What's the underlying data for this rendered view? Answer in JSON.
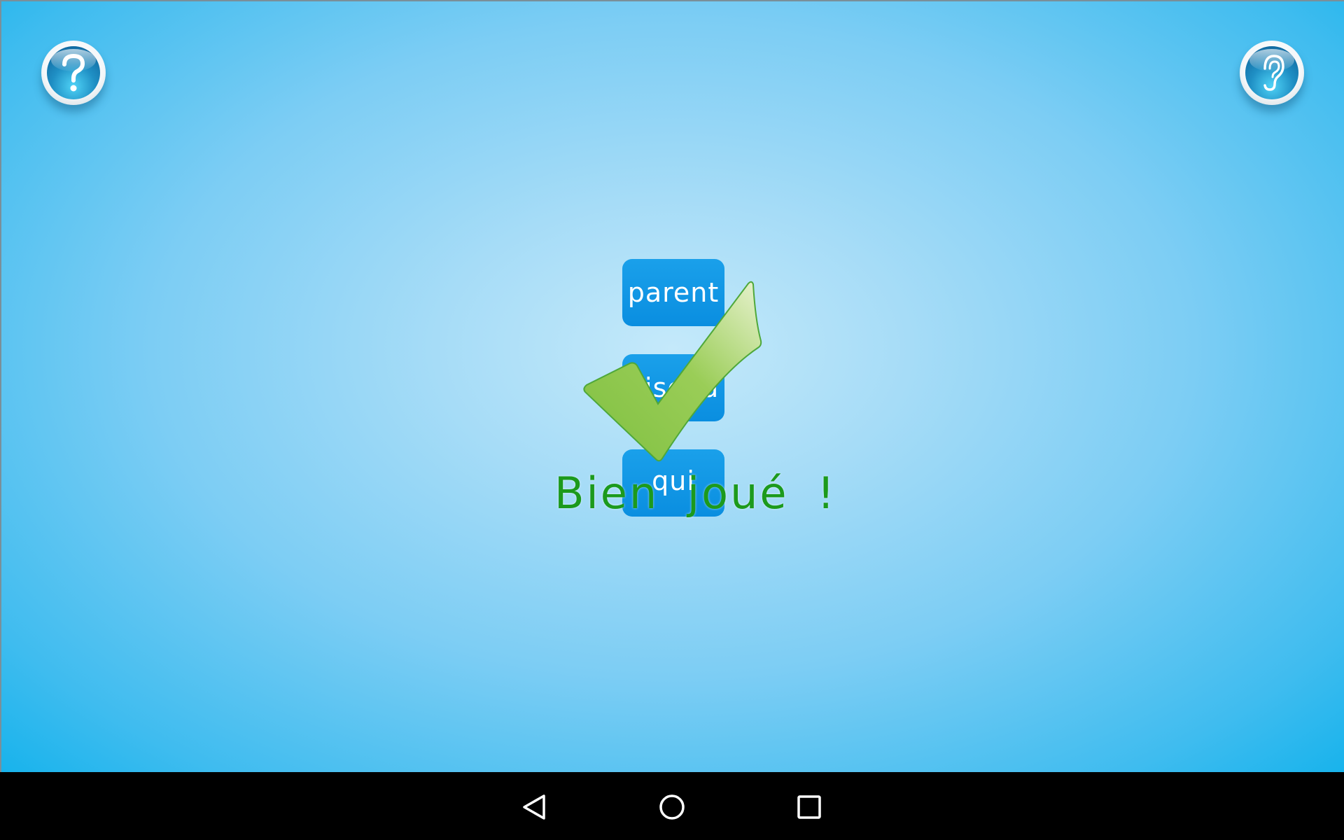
{
  "game": {
    "words": [
      "parent",
      "oiseau",
      "qui"
    ],
    "feedback_text": "Bien joué !",
    "feedback_color": "#1c9a1c",
    "tile_color": "#0a8ee0",
    "background_color": "#a6dcf7"
  },
  "toolbar": {
    "help_icon": "question-mark-icon",
    "listen_icon": "ear-icon"
  },
  "navigation": {
    "back_icon": "triangle-back-icon",
    "home_icon": "circle-home-icon",
    "recents_icon": "square-recents-icon"
  }
}
